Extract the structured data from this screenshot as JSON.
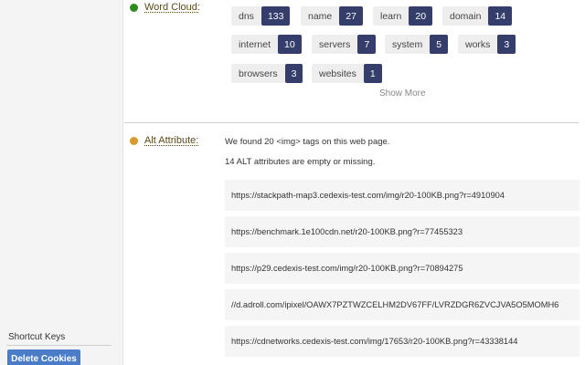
{
  "sidebar": {
    "shortcut_label": "Shortcut Keys",
    "delete_button": "Delete Cookies"
  },
  "word_cloud": {
    "label": "Word Cloud:",
    "status_color": "#2e8b1e",
    "tags": [
      {
        "name": "dns",
        "count": "133"
      },
      {
        "name": "name",
        "count": "27"
      },
      {
        "name": "learn",
        "count": "20"
      },
      {
        "name": "domain",
        "count": "14"
      },
      {
        "name": "internet",
        "count": "10"
      },
      {
        "name": "servers",
        "count": "7"
      },
      {
        "name": "system",
        "count": "5"
      },
      {
        "name": "works",
        "count": "3"
      },
      {
        "name": "browsers",
        "count": "3"
      },
      {
        "name": "websites",
        "count": "1"
      }
    ],
    "show_more": "Show More"
  },
  "alt_attribute": {
    "label": "Alt Attribute:",
    "status_color": "#d99a2b",
    "summary_line1": "We found 20 <img> tags on this web page.",
    "summary_line2": "14 ALT attributes are empty or missing.",
    "urls": [
      "https://stackpath-map3.cedexis-test.com/img/r20-100KB.png?r=4910904",
      "https://benchmark.1e100cdn.net/r20-100KB.png?r=77455323",
      "https://p29.cedexis-test.com/img/r20-100KB.png?r=70894275",
      "//d.adroll.com/ipixel/OAWX7PZTWZCELHM2DV67FF/LVRZDGR6ZVCJVA5O5MOMH6",
      "https://cdnetworks.cedexis-test.com/img/17653/r20-100KB.png?r=43338144"
    ]
  }
}
